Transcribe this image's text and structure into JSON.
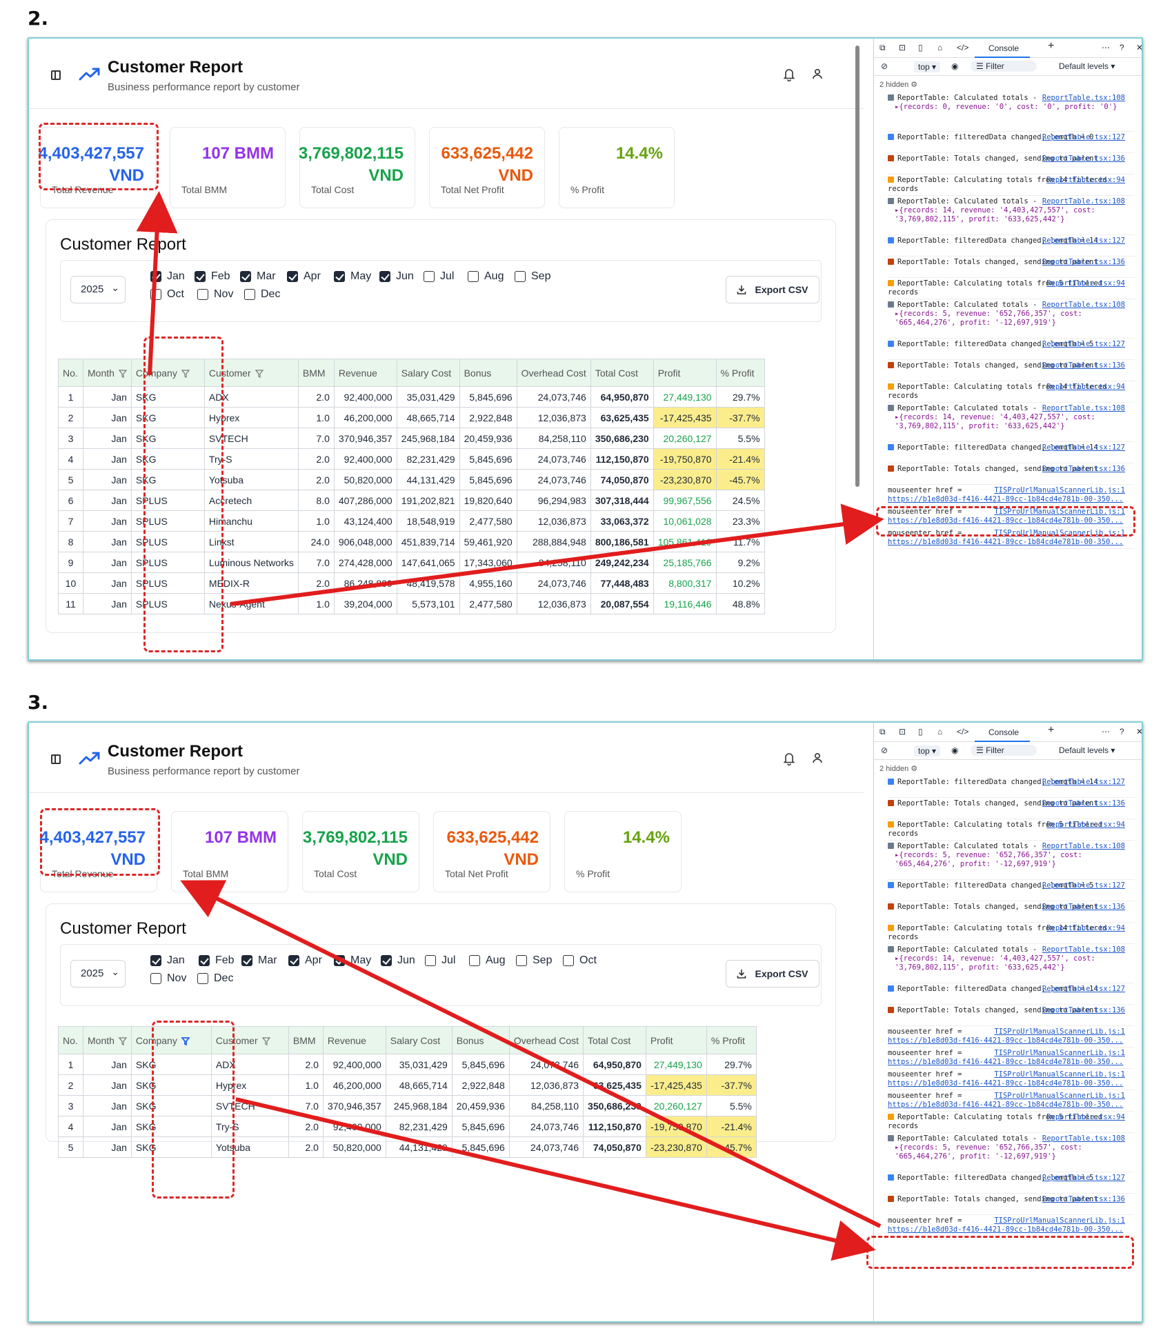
{
  "panels": [
    {
      "step": "2.",
      "app": {
        "title": "Customer Report",
        "subtitle": "Business performance report by customer"
      },
      "cards": [
        {
          "value": "4,403,427,557",
          "unit": "VND",
          "label": "Total Revenue",
          "color": "#2563eb"
        },
        {
          "value": "107 BMM",
          "unit": "",
          "label": "Total BMM",
          "color": "#9333ea"
        },
        {
          "value": "3,769,802,115",
          "unit": "VND",
          "label": "Total Cost",
          "color": "#16a34a"
        },
        {
          "value": "633,625,442",
          "unit": "VND",
          "label": "Total Net Profit",
          "color": "#ea580c"
        },
        {
          "value": "14.4%",
          "unit": "",
          "label": "% Profit",
          "color": "#65a30d"
        }
      ],
      "report_title": "Customer Report",
      "year": "2025",
      "export_label": "Export CSV",
      "months": [
        {
          "label": "Jan",
          "checked": true
        },
        {
          "label": "Feb",
          "checked": true
        },
        {
          "label": "Mar",
          "checked": true
        },
        {
          "label": "Apr",
          "checked": true
        },
        {
          "label": "May",
          "checked": true
        },
        {
          "label": "Jun",
          "checked": true
        },
        {
          "label": "Jul",
          "checked": false
        },
        {
          "label": "Aug",
          "checked": false
        },
        {
          "label": "Sep",
          "checked": false
        },
        {
          "label": "Oct",
          "checked": false
        },
        {
          "label": "Nov",
          "checked": false
        },
        {
          "label": "Dec",
          "checked": false
        }
      ],
      "columns": [
        "No.",
        "Month",
        "Company",
        "Customer",
        "BMM",
        "Revenue",
        "Salary Cost",
        "Bonus",
        "Overhead Cost",
        "Total Cost",
        "Profit",
        "% Profit"
      ],
      "rows": [
        [
          "1",
          "Jan",
          "SKG",
          "ADX",
          "2.0",
          "92,400,000",
          "35,031,429",
          "5,845,696",
          "24,073,746",
          "64,950,870",
          "27,449,130",
          "29.7%"
        ],
        [
          "2",
          "Jan",
          "SKG",
          "Hyprex",
          "1.0",
          "46,200,000",
          "48,665,714",
          "2,922,848",
          "12,036,873",
          "63,625,435",
          "-17,425,435",
          "-37.7%"
        ],
        [
          "3",
          "Jan",
          "SKG",
          "SVTECH",
          "7.0",
          "370,946,357",
          "245,968,184",
          "20,459,936",
          "84,258,110",
          "350,686,230",
          "20,260,127",
          "5.5%"
        ],
        [
          "4",
          "Jan",
          "SKG",
          "Try-S",
          "2.0",
          "92,400,000",
          "82,231,429",
          "5,845,696",
          "24,073,746",
          "112,150,870",
          "-19,750,870",
          "-21.4%"
        ],
        [
          "5",
          "Jan",
          "SKG",
          "Yotsuba",
          "2.0",
          "50,820,000",
          "44,131,429",
          "5,845,696",
          "24,073,746",
          "74,050,870",
          "-23,230,870",
          "-45.7%"
        ],
        [
          "6",
          "Jan",
          "SPLUS",
          "Accretech",
          "8.0",
          "407,286,000",
          "191,202,821",
          "19,820,640",
          "96,294,983",
          "307,318,444",
          "99,967,556",
          "24.5%"
        ],
        [
          "7",
          "Jan",
          "SPLUS",
          "Himanchu",
          "1.0",
          "43,124,400",
          "18,548,919",
          "2,477,580",
          "12,036,873",
          "33,063,372",
          "10,061,028",
          "23.3%"
        ],
        [
          "8",
          "Jan",
          "SPLUS",
          "Linkst",
          "24.0",
          "906,048,000",
          "451,839,714",
          "59,461,920",
          "288,884,948",
          "800,186,581",
          "105,861,419",
          "11.7%"
        ],
        [
          "9",
          "Jan",
          "SPLUS",
          "Luminous Networks",
          "7.0",
          "274,428,000",
          "147,641,065",
          "17,343,060",
          "84,258,110",
          "249,242,234",
          "25,185,766",
          "9.2%"
        ],
        [
          "10",
          "Jan",
          "SPLUS",
          "MEDIX-R",
          "2.0",
          "86,248,800",
          "48,419,578",
          "4,955,160",
          "24,073,746",
          "77,448,483",
          "8,800,317",
          "10.2%"
        ],
        [
          "11",
          "Jan",
          "SPLUS",
          "Nexus-Agent",
          "1.0",
          "39,204,000",
          "5,573,101",
          "2,477,580",
          "12,036,873",
          "20,087,554",
          "19,116,446",
          "48.8%"
        ]
      ],
      "devtools": {
        "console_tab": "Console",
        "context": "top",
        "filter_placeholder": "Filter",
        "levels": "Default levels",
        "hidden": "2 hidden",
        "logs": [
          {
            "type": "calc",
            "text": "ReportTable: Calculated totals -",
            "obj": "{records: 0, revenue: '0', cost: '0', profit: '0'}",
            "src": "ReportTable.tsx:108"
          },
          {
            "type": "data",
            "text": "ReportTable: filteredData changed, length = 0",
            "src": "ReportTable.tsx:127"
          },
          {
            "type": "send",
            "text": "ReportTable: Totals changed, sending to parent",
            "src": "ReportTable.tsx:136"
          },
          {
            "type": "calcing",
            "text": "ReportTable: Calculating totals from 14 filtered records",
            "src": "ReportTable.tsx:94"
          },
          {
            "type": "calc",
            "text": "ReportTable: Calculated totals -",
            "obj": "{records: 14, revenue: '4,403,427,557', cost: '3,769,802,115', profit: '633,625,442'}",
            "src": "ReportTable.tsx:108"
          },
          {
            "type": "data",
            "text": "ReportTable: filteredData changed, length = 14",
            "src": "ReportTable.tsx:127"
          },
          {
            "type": "send",
            "text": "ReportTable: Totals changed, sending to parent",
            "src": "ReportTable.tsx:136"
          },
          {
            "type": "calcing",
            "text": "ReportTable: Calculating totals from 5 filtered records",
            "src": "ReportTable.tsx:94"
          },
          {
            "type": "calc",
            "text": "ReportTable: Calculated totals -",
            "obj": "{records: 5, revenue: '652,766,357', cost: '665,464,276', profit: '-12,697,919'}",
            "src": "ReportTable.tsx:108"
          },
          {
            "type": "data",
            "text": "ReportTable: filteredData changed, length = 5",
            "src": "ReportTable.tsx:127"
          },
          {
            "type": "send",
            "text": "ReportTable: Totals changed, sending to parent",
            "src": "ReportTable.tsx:136"
          },
          {
            "type": "calcing",
            "text": "ReportTable: Calculating totals from 14 filtered records",
            "src": "ReportTable.tsx:94"
          },
          {
            "type": "calc",
            "text": "ReportTable: Calculated totals -",
            "obj": "{records: 14, revenue: '4,403,427,557', cost: '3,769,802,115', profit: '633,625,442'}",
            "src": "ReportTable.tsx:108"
          },
          {
            "type": "data",
            "text": "ReportTable: filteredData changed, length = 14",
            "src": "ReportTable.tsx:127"
          },
          {
            "type": "send",
            "text": "ReportTable: Totals changed, sending to parent",
            "src": "ReportTable.tsx:136"
          },
          {
            "type": "mouse",
            "text": "mouseenter href =",
            "href": "https://b1e8d03d-f416-4421-89cc-1b84cd4e781b-00-350...",
            "src": "TISProUrlManualScannerLib.js:1"
          },
          {
            "type": "mouse",
            "text": "mouseenter href =",
            "href": "https://b1e8d03d-f416-4421-89cc-1b84cd4e781b-00-350...",
            "src": "TISProUrlManualScannerLib.js:1"
          },
          {
            "type": "mouse",
            "text": "mouseenter href =",
            "href": "https://b1e8d03d-f416-4421-89cc-1b84cd4e781b-00-350...",
            "src": "TISProUrlManualScannerLib.js:1"
          }
        ]
      }
    },
    {
      "step": "3.",
      "app": {
        "title": "Customer Report",
        "subtitle": "Business performance report by customer"
      },
      "cards": [
        {
          "value": "4,403,427,557",
          "unit": "VND",
          "label": "Total Revenue",
          "color": "#2563eb"
        },
        {
          "value": "107 BMM",
          "unit": "",
          "label": "Total BMM",
          "color": "#9333ea"
        },
        {
          "value": "3,769,802,115",
          "unit": "VND",
          "label": "Total Cost",
          "color": "#16a34a"
        },
        {
          "value": "633,625,442",
          "unit": "VND",
          "label": "Total Net Profit",
          "color": "#ea580c"
        },
        {
          "value": "14.4%",
          "unit": "",
          "label": "% Profit",
          "color": "#65a30d"
        }
      ],
      "report_title": "Customer Report",
      "year": "2025",
      "export_label": "Export CSV",
      "months": [
        {
          "label": "Jan",
          "checked": true
        },
        {
          "label": "Feb",
          "checked": true
        },
        {
          "label": "Mar",
          "checked": true
        },
        {
          "label": "Apr",
          "checked": true
        },
        {
          "label": "May",
          "checked": true
        },
        {
          "label": "Jun",
          "checked": true
        },
        {
          "label": "Jul",
          "checked": false
        },
        {
          "label": "Aug",
          "checked": false
        },
        {
          "label": "Sep",
          "checked": false
        },
        {
          "label": "Oct",
          "checked": false
        },
        {
          "label": "Nov",
          "checked": false
        },
        {
          "label": "Dec",
          "checked": false
        }
      ],
      "columns": [
        "No.",
        "Month",
        "Company",
        "Customer",
        "BMM",
        "Revenue",
        "Salary Cost",
        "Bonus",
        "Overhead Cost",
        "Total Cost",
        "Profit",
        "% Profit"
      ],
      "rows": [
        [
          "1",
          "Jan",
          "SKG",
          "ADX",
          "2.0",
          "92,400,000",
          "35,031,429",
          "5,845,696",
          "24,073,746",
          "64,950,870",
          "27,449,130",
          "29.7%"
        ],
        [
          "2",
          "Jan",
          "SKG",
          "Hyprex",
          "1.0",
          "46,200,000",
          "48,665,714",
          "2,922,848",
          "12,036,873",
          "63,625,435",
          "-17,425,435",
          "-37.7%"
        ],
        [
          "3",
          "Jan",
          "SKG",
          "SVTECH",
          "7.0",
          "370,946,357",
          "245,968,184",
          "20,459,936",
          "84,258,110",
          "350,686,230",
          "20,260,127",
          "5.5%"
        ],
        [
          "4",
          "Jan",
          "SKG",
          "Try-S",
          "2.0",
          "92,400,000",
          "82,231,429",
          "5,845,696",
          "24,073,746",
          "112,150,870",
          "-19,750,870",
          "-21.4%"
        ],
        [
          "5",
          "Jan",
          "SKG",
          "Yotsuba",
          "2.0",
          "50,820,000",
          "44,131,429",
          "5,845,696",
          "24,073,746",
          "74,050,870",
          "-23,230,870",
          "-45.7%"
        ]
      ],
      "devtools": {
        "console_tab": "Console",
        "context": "top",
        "filter_placeholder": "Filter",
        "levels": "Default levels",
        "hidden": "2 hidden",
        "logs": [
          {
            "type": "data",
            "text": "ReportTable: filteredData changed, length = 14",
            "src": "ReportTable.tsx:127"
          },
          {
            "type": "send",
            "text": "ReportTable: Totals changed, sending to parent",
            "src": "ReportTable.tsx:136"
          },
          {
            "type": "calcing",
            "text": "ReportTable: Calculating totals from 5 filtered records",
            "src": "ReportTable.tsx:94"
          },
          {
            "type": "calc",
            "text": "ReportTable: Calculated totals -",
            "obj": "{records: 5, revenue: '652,766,357', cost: '665,464,276', profit: '-12,697,919'}",
            "src": "ReportTable.tsx:108"
          },
          {
            "type": "data",
            "text": "ReportTable: filteredData changed, length = 5",
            "src": "ReportTable.tsx:127"
          },
          {
            "type": "send",
            "text": "ReportTable: Totals changed, sending to parent",
            "src": "ReportTable.tsx:136"
          },
          {
            "type": "calcing",
            "text": "ReportTable: Calculating totals from 14 filtered records",
            "src": "ReportTable.tsx:94"
          },
          {
            "type": "calc",
            "text": "ReportTable: Calculated totals -",
            "obj": "{records: 14, revenue: '4,403,427,557', cost: '3,769,802,115', profit: '633,625,442'}",
            "src": "ReportTable.tsx:108"
          },
          {
            "type": "data",
            "text": "ReportTable: filteredData changed, length = 14",
            "src": "ReportTable.tsx:127"
          },
          {
            "type": "send",
            "text": "ReportTable: Totals changed, sending to parent",
            "src": "ReportTable.tsx:136"
          },
          {
            "type": "mouse",
            "text": "mouseenter href =",
            "href": "https://b1e8d03d-f416-4421-89cc-1b84cd4e781b-00-350...",
            "src": "TISProUrlManualScannerLib.js:1"
          },
          {
            "type": "mouse",
            "text": "mouseenter href =",
            "href": "https://b1e8d03d-f416-4421-89cc-1b84cd4e781b-00-350...",
            "src": "TISProUrlManualScannerLib.js:1"
          },
          {
            "type": "mouse",
            "text": "mouseenter href =",
            "href": "https://b1e8d03d-f416-4421-89cc-1b84cd4e781b-00-350...",
            "src": "TISProUrlManualScannerLib.js:1"
          },
          {
            "type": "mouse",
            "text": "mouseenter href =",
            "href": "https://b1e8d03d-f416-4421-89cc-1b84cd4e781b-00-350...",
            "src": "TISProUrlManualScannerLib.js:1"
          },
          {
            "type": "calcing",
            "text": "ReportTable: Calculating totals from 5 filtered records",
            "src": "ReportTable.tsx:94"
          },
          {
            "type": "calc",
            "text": "ReportTable: Calculated totals -",
            "obj": "{records: 5, revenue: '652,766,357', cost: '665,464,276', profit: '-12,697,919'}",
            "src": "ReportTable.tsx:108"
          },
          {
            "type": "data",
            "text": "ReportTable: filteredData changed, length = 5",
            "src": "ReportTable.tsx:127"
          },
          {
            "type": "send",
            "text": "ReportTable: Totals changed, sending to parent",
            "src": "ReportTable.tsx:136"
          },
          {
            "type": "mouse",
            "text": "mouseenter href =",
            "href": "https://b1e8d03d-f416-4421-89cc-1b84cd4e781b-00-350...",
            "src": "TISProUrlManualScannerLib.js:1"
          }
        ]
      }
    }
  ]
}
